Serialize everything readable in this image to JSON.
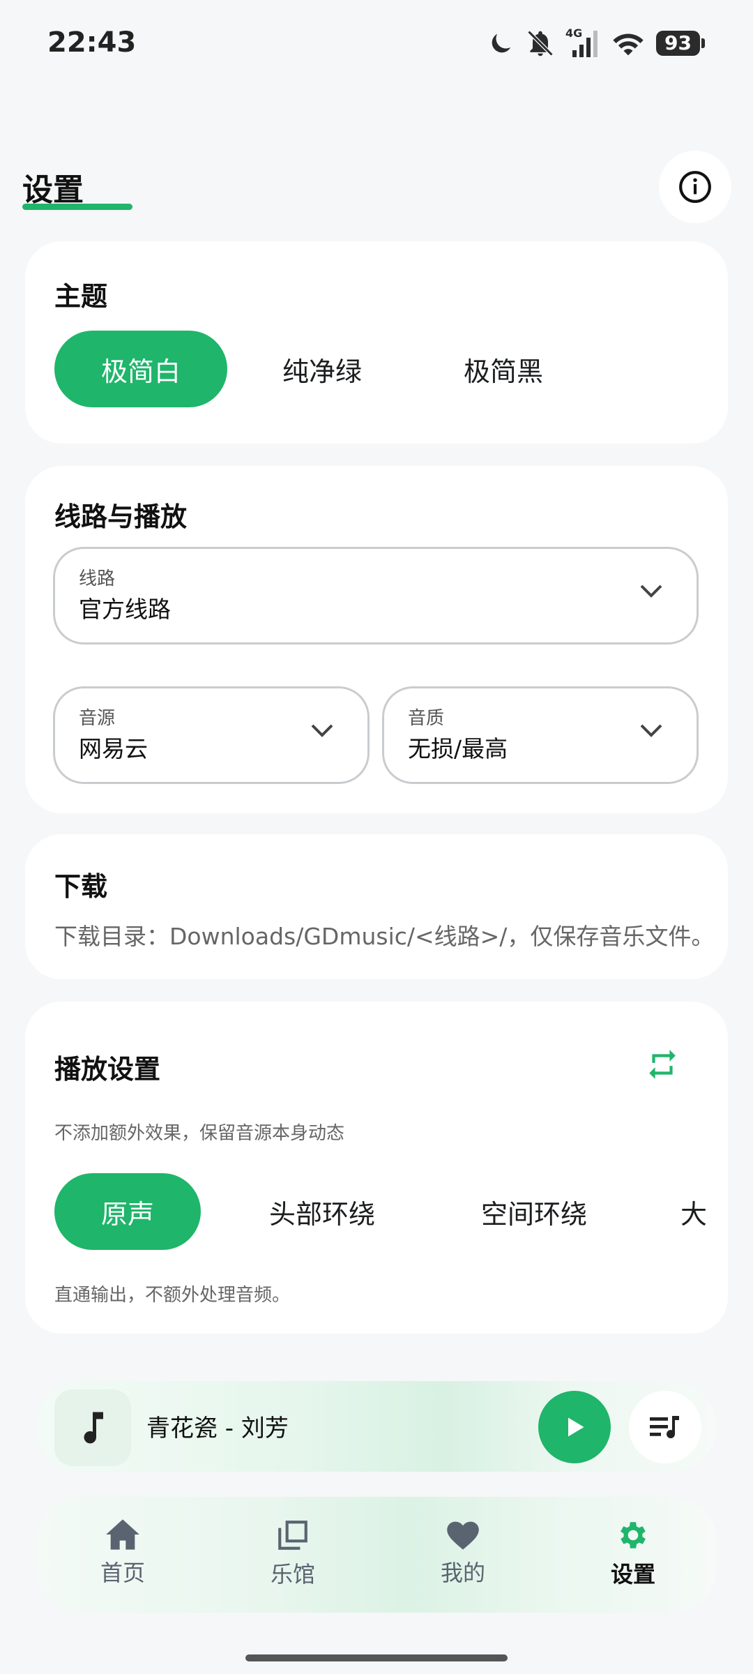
{
  "status_bar": {
    "time": "22:43",
    "network": "4G",
    "battery": "93"
  },
  "header": {
    "title": "设置"
  },
  "theme": {
    "title": "主题",
    "options": [
      {
        "label": "极简白",
        "active": true
      },
      {
        "label": "纯净绿",
        "active": false
      },
      {
        "label": "极简黑",
        "active": false
      }
    ]
  },
  "route": {
    "title": "线路与播放",
    "route_select": {
      "label": "线路",
      "value": "官方线路"
    },
    "source_select": {
      "label": "音源",
      "value": "网易云"
    },
    "quality_select": {
      "label": "音质",
      "value": "无损/最高"
    }
  },
  "download": {
    "title": "下载",
    "description": "下载目录：Downloads/GDmusic/<线路>/，仅保存音乐文件。"
  },
  "playback": {
    "title": "播放设置",
    "subtitle": "不添加额外效果，保留音源本身动态",
    "modes": [
      {
        "label": "原声",
        "active": true
      },
      {
        "label": "头部环绕",
        "active": false
      },
      {
        "label": "空间环绕",
        "active": false
      },
      {
        "label": "大",
        "active": false
      }
    ],
    "mode_description": "直通输出，不额外处理音频。"
  },
  "player": {
    "now_playing": "青花瓷 - 刘芳"
  },
  "nav": {
    "items": [
      {
        "label": "首页",
        "icon": "home-icon"
      },
      {
        "label": "乐馆",
        "icon": "library-icon"
      },
      {
        "label": "我的",
        "icon": "heart-icon"
      },
      {
        "label": "设置",
        "icon": "gear-icon",
        "active": true
      }
    ]
  },
  "colors": {
    "accent": "#1fb56b",
    "background": "#f5f7f8",
    "card": "#ffffff"
  }
}
